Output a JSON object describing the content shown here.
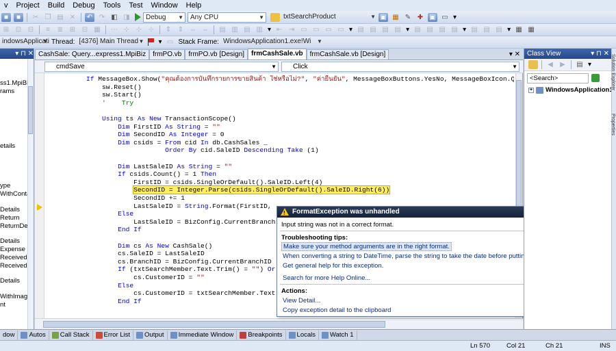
{
  "menu": [
    "v",
    "Project",
    "Build",
    "Debug",
    "Tools",
    "Test",
    "Window",
    "Help"
  ],
  "toolbar": {
    "config": "Debug",
    "platform": "Any CPU",
    "find_target": "txtSearchProduct"
  },
  "debug_bar": {
    "process_label": "indowsApplicatio",
    "thread_label": "Thread:",
    "thread_value": "[4376] Main Thread",
    "stack_label": "Stack Frame:",
    "stack_value": "WindowsApplication1.exe!Wi"
  },
  "left_panel": {
    "items": [
      "ss1.MpiBiz",
      "rams",
      "etails",
      "ype",
      "WithContac",
      "Details",
      "Return",
      "ReturnDet",
      "Details",
      "Expense",
      "Received",
      "ReceivedD",
      "Details",
      "WithImage",
      "nt"
    ]
  },
  "tabs": [
    {
      "label": "CashSale: Query...express1.MpiBiz"
    },
    {
      "label": "frmPO.vb"
    },
    {
      "label": "frmPO.vb [Design]"
    },
    {
      "label": "frmCashSale.vb"
    },
    {
      "label": "frmCashSale.vb [Design]"
    }
  ],
  "editor": {
    "object_combo": "cmdSave",
    "event_combo": "Click",
    "code": [
      "If MessageBox.Show(\"คุณต้องการบันทึกรายการขายสินค้า ใช่หรือไม่?\", \"ค่ายืนยัน\", MessageBoxButtons.YesNo, MessageBoxIcon.Ques",
      "    sw.Reset()",
      "    sw.Start()",
      "    '    Try",
      "",
      "    Using ts As New TransactionScope()",
      "        Dim FirstID As String = \"\"",
      "        Dim SecondID As Integer = 0",
      "        Dim csids = From cid In db.CashSales _",
      "                    Order By cid.SaleID Descending Take (1)",
      "",
      "        Dim LastSaleID As String = \"\"",
      "        If csids.Count() = 1 Then",
      "            FirstID = csids.SingleOrDefault().SaleID.Left(4)",
      "            SecondID = Integer.Parse(csids.SingleOrDefault().SaleID.Right(6))",
      "            SecondID += 1",
      "            LastSaleID = String.Format(FirstID,",
      "        Else",
      "            LastSaleID = BizConfig.CurrentBranch",
      "        End If",
      "",
      "        Dim cs As New CashSale()",
      "        cs.SaleID = LastSaleID",
      "        cs.BranchID = BizConfig.CurrentBranchID",
      "        If (txtSearchMember.Text.Trim() = \"\") Or",
      "            cs.CustomerID = \"\"",
      "        Else",
      "            cs.CustomerID = txtSearchMember.Text",
      "        End If"
    ]
  },
  "exception": {
    "title": "FormatException was unhandled",
    "message": "Input string was not in a correct format.",
    "tips_header": "Troubleshooting tips:",
    "tips": [
      "Make sure your method arguments are in the right format.",
      "When converting a string to DateTime, parse the string to take the date before putting each variable into the DateTime object.",
      "Get general help for this exception."
    ],
    "search_link": "Search for more Help Online...",
    "actions_header": "Actions:",
    "actions": [
      "View Detail...",
      "Copy exception detail to the clipboard"
    ]
  },
  "class_view": {
    "title": "Class View",
    "search_placeholder": "<Search>",
    "root": "WindowsApplication1"
  },
  "side_strip": [
    "Solution Explorer",
    "Properties"
  ],
  "bottom_tabs": [
    "dow",
    "Autos",
    "Call Stack",
    "Error List",
    "Output",
    "Immediate Window",
    "Breakpoints",
    "Locals",
    "Watch 1"
  ],
  "status": {
    "ln": "Ln 570",
    "col": "Col 21",
    "ch": "Ch 21",
    "mode": "INS"
  }
}
